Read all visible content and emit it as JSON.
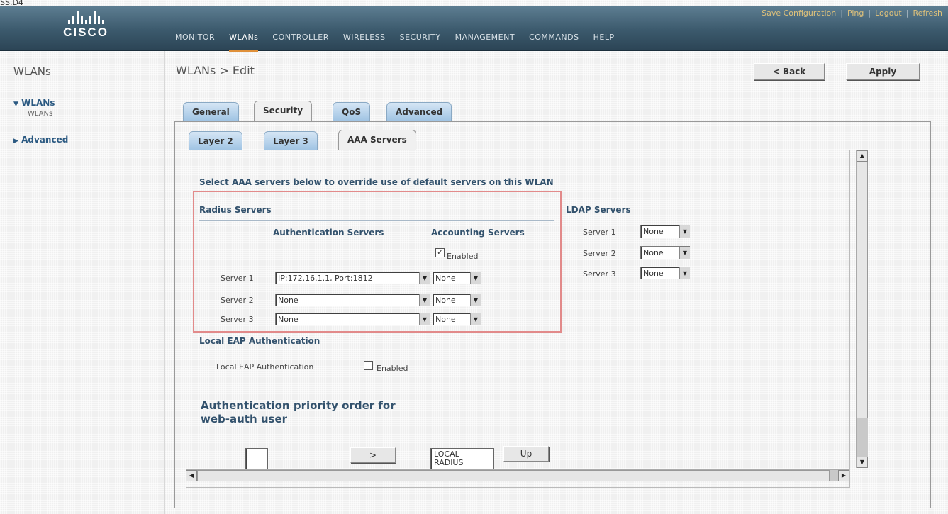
{
  "top_fragment": "SS.D4",
  "header": {
    "brand": "CISCO",
    "links": [
      "Save Configuration",
      "Ping",
      "Logout",
      "Refresh"
    ],
    "nav": [
      "MONITOR",
      "WLANs",
      "CONTROLLER",
      "WIRELESS",
      "SECURITY",
      "MANAGEMENT",
      "COMMANDS",
      "HELP"
    ],
    "active_nav": "WLANs",
    "colors": {
      "header": "#3c5a6d",
      "active_underline": "#e0913a",
      "links": "#e0c27a"
    }
  },
  "sidebar": {
    "title": "WLANs",
    "items": [
      {
        "label": "WLANs",
        "expanded": true,
        "subitems": [
          "WLANs"
        ]
      },
      {
        "label": "Advanced",
        "expanded": false
      }
    ]
  },
  "page": {
    "title": "WLANs > Edit",
    "back_label": "< Back",
    "apply_label": "Apply"
  },
  "tabs": {
    "main": [
      "General",
      "Security",
      "QoS",
      "Advanced"
    ],
    "main_active": "Security",
    "sub": [
      "Layer 2",
      "Layer 3",
      "AAA Servers"
    ],
    "sub_active": "AAA Servers"
  },
  "aaa": {
    "intro": "Select AAA servers below to override use of default servers on this WLAN",
    "radius": {
      "heading": "Radius Servers",
      "auth_header": "Authentication Servers",
      "acct_header": "Accounting Servers",
      "acct_enabled_label": "Enabled",
      "acct_enabled": true,
      "rows": [
        {
          "label": "Server 1",
          "auth": "IP:172.16.1.1, Port:1812",
          "acct": "None"
        },
        {
          "label": "Server 2",
          "auth": "None",
          "acct": "None"
        },
        {
          "label": "Server 3",
          "auth": "None",
          "acct": "None"
        }
      ]
    },
    "ldap": {
      "heading": "LDAP Servers",
      "rows": [
        {
          "label": "Server 1",
          "value": "None"
        },
        {
          "label": "Server 2",
          "value": "None"
        },
        {
          "label": "Server 3",
          "value": "None"
        }
      ]
    },
    "local_eap": {
      "heading": "Local EAP Authentication",
      "label": "Local EAP Authentication",
      "enabled_label": "Enabled",
      "enabled": false
    },
    "priority": {
      "heading_line1": "Authentication priority order for",
      "heading_line2": "web-auth user",
      "move_label": ">",
      "order_items": [
        "LOCAL",
        "RADIUS"
      ],
      "up_label": "Up"
    }
  }
}
